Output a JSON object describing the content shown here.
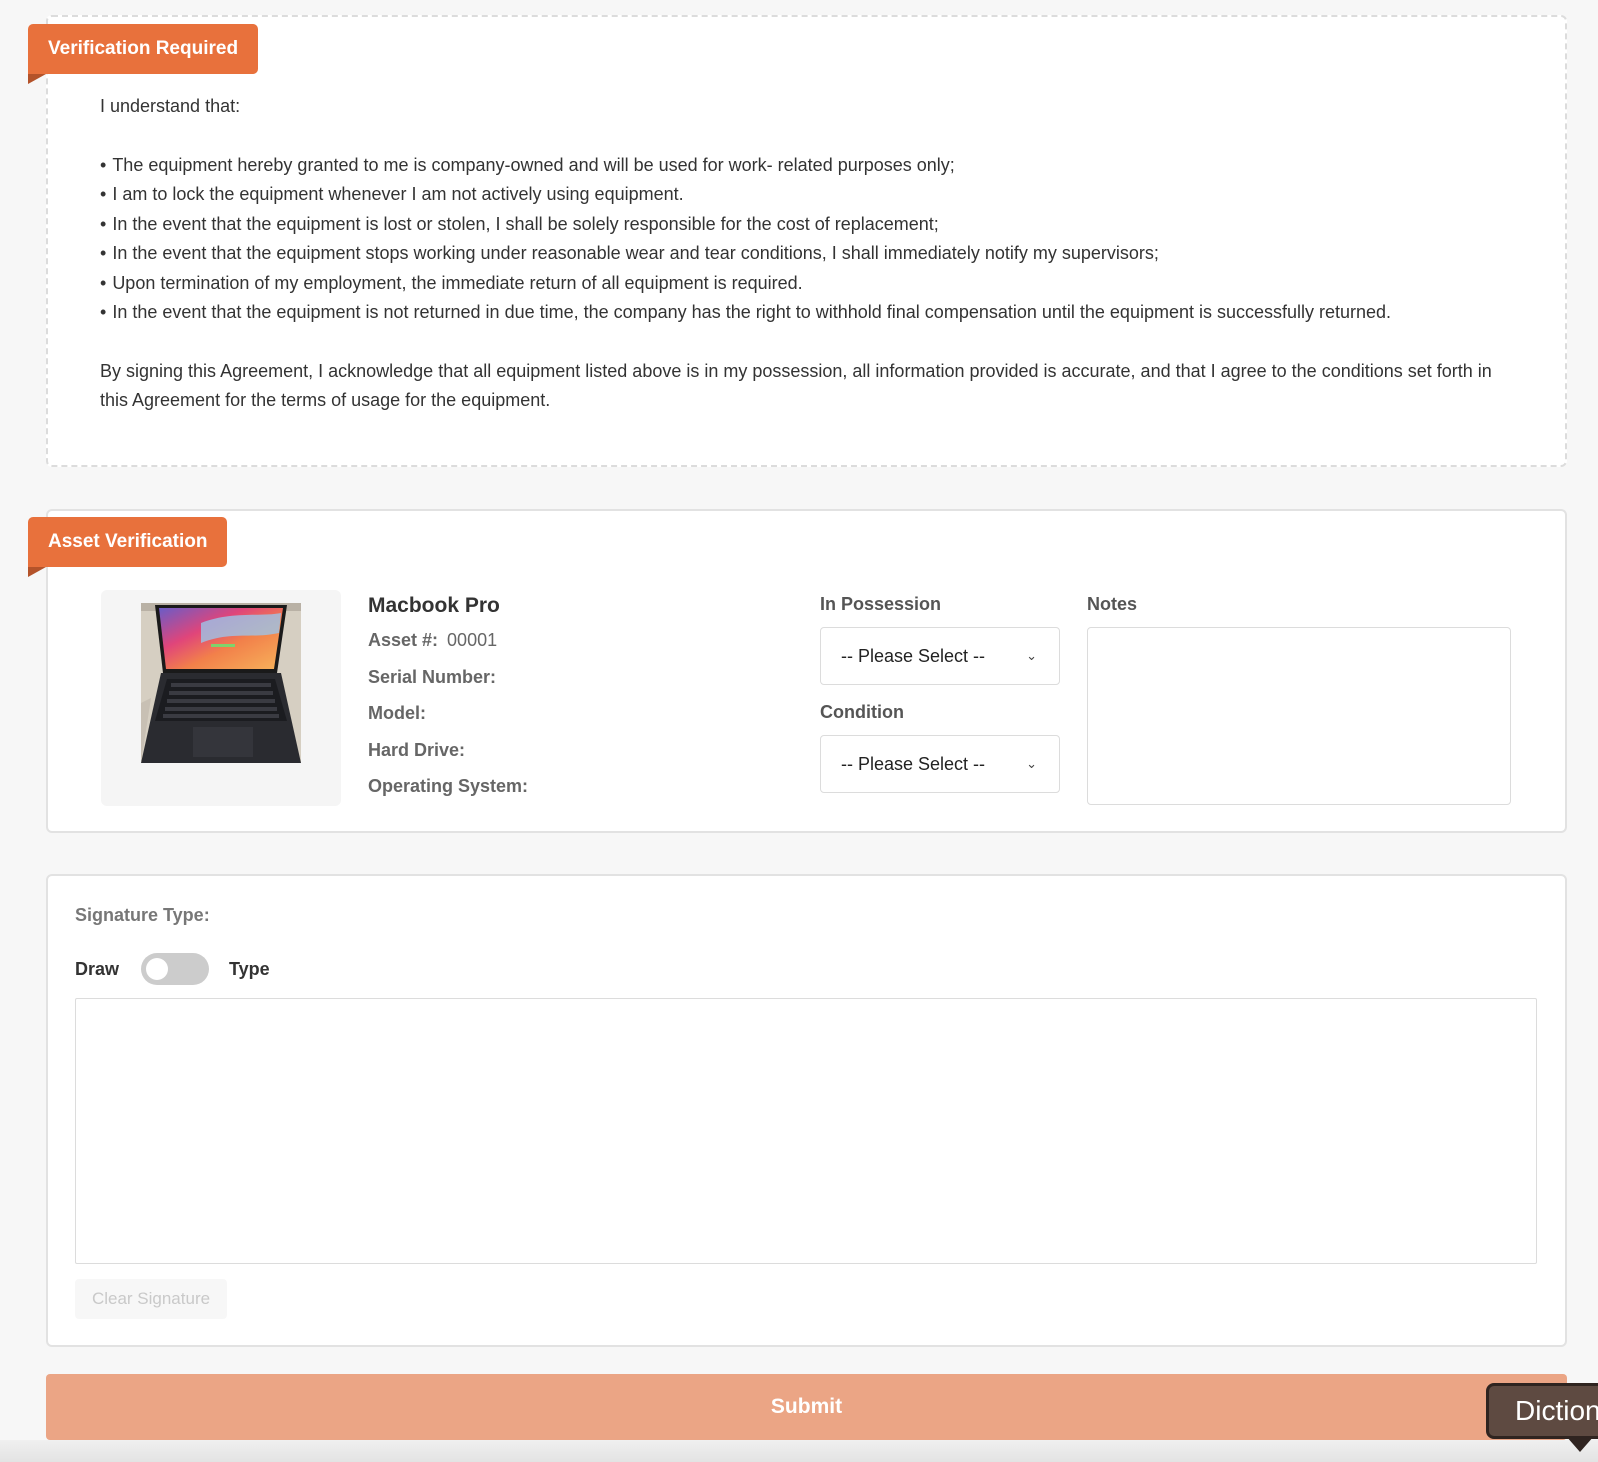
{
  "verification": {
    "ribbon": "Verification Required",
    "intro": "I understand that:",
    "bullets": [
      "The equipment hereby granted to me is company-owned and will be used for work- related purposes only;",
      "I am to lock the equipment whenever I am not actively using equipment.",
      "In the event that the equipment is lost or stolen, I shall be solely responsible for the cost of replacement;",
      "In the event that the equipment stops working under reasonable wear and tear conditions, I shall immediately notify my supervisors;",
      "Upon termination of my employment, the immediate return of all equipment is required.",
      "In the event that the equipment is not returned in due time, the company has the right to withhold final compensation until the equipment is successfully returned."
    ],
    "closing": "By signing this Agreement, I acknowledge that all equipment listed above is in my possession, all information provided is accurate, and that I agree to the conditions set forth in this Agreement for the terms of usage for the equipment."
  },
  "asset": {
    "ribbon": "Asset Verification",
    "name": "Macbook Pro",
    "asset_number_label": "Asset #:",
    "asset_number": "00001",
    "serial_label": "Serial Number:",
    "serial_value": "",
    "model_label": "Model:",
    "model_value": "",
    "hard_drive_label": "Hard Drive:",
    "hard_drive_value": "",
    "os_label": "Operating System:",
    "os_value": "",
    "in_possession_label": "In Possession",
    "in_possession_value": "-- Please Select --",
    "condition_label": "Condition",
    "condition_value": "-- Please Select --",
    "notes_label": "Notes",
    "notes_value": ""
  },
  "signature": {
    "title": "Signature Type:",
    "draw_label": "Draw",
    "type_label": "Type",
    "clear_label": "Clear Signature"
  },
  "submit_label": "Submit",
  "dictionary_popup": "Diction",
  "colors": {
    "accent": "#e8713c",
    "submit_disabled": "#eba585"
  }
}
